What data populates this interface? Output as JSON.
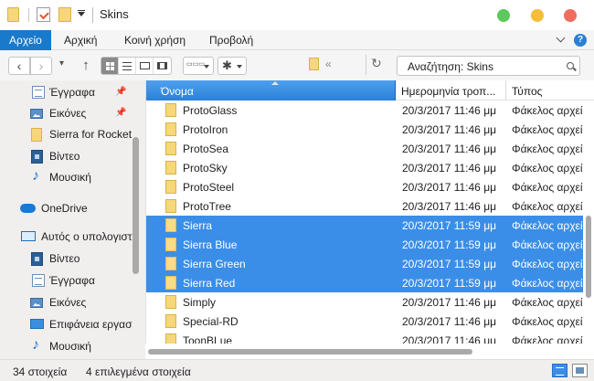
{
  "window": {
    "title": "Skins"
  },
  "ribbon": {
    "tabs": [
      {
        "label": "Αρχείο",
        "active": true
      },
      {
        "label": "Αρχική",
        "active": false
      },
      {
        "label": "Κοινή χρήση",
        "active": false
      },
      {
        "label": "Προβολή",
        "active": false
      }
    ],
    "help": "?"
  },
  "toolbar": {
    "back": "‹",
    "forward": "›",
    "up": "↑",
    "address_overflow": "«",
    "refresh": "↻",
    "search_placeholder": "Αναζήτηση: Skins",
    "gear": "✱",
    "arrange": "▭▭▭"
  },
  "sidebar": {
    "items": [
      {
        "label": "Έγγραφα",
        "icon": "documents-icon",
        "pinned": true
      },
      {
        "label": "Εικόνες",
        "icon": "pictures-icon",
        "pinned": true
      },
      {
        "label": "Sierra for Rocket",
        "icon": "folder-icon",
        "pinned": false
      },
      {
        "label": "Βίντεο",
        "icon": "video-icon",
        "pinned": false
      },
      {
        "label": "Μουσική",
        "icon": "music-icon",
        "pinned": false
      },
      {
        "label": "OneDrive",
        "icon": "onedrive-icon",
        "pinned": false
      },
      {
        "label": "Αυτός ο υπολογιστ",
        "icon": "this-pc-icon",
        "pinned": false
      },
      {
        "label": "Βίντεο",
        "icon": "video-icon",
        "pinned": false
      },
      {
        "label": "Έγγραφα",
        "icon": "documents-icon",
        "pinned": false
      },
      {
        "label": "Εικόνες",
        "icon": "pictures-icon",
        "pinned": false
      },
      {
        "label": "Επιφάνεια εργασ",
        "icon": "desktop-icon",
        "pinned": false
      },
      {
        "label": "Μουσική",
        "icon": "music-icon",
        "pinned": false
      }
    ],
    "pin_glyph": "📌"
  },
  "filelist": {
    "columns": {
      "name": "Όνομα",
      "date": "Ημερομηνία τροπ...",
      "type": "Τύπος"
    },
    "rows": [
      {
        "name": "ProtoGlass",
        "date": "20/3/2017 11:46 μμ",
        "type": "Φάκελος αρχεί",
        "selected": false
      },
      {
        "name": "ProtoIron",
        "date": "20/3/2017 11:46 μμ",
        "type": "Φάκελος αρχεί",
        "selected": false
      },
      {
        "name": "ProtoSea",
        "date": "20/3/2017 11:46 μμ",
        "type": "Φάκελος αρχεί",
        "selected": false
      },
      {
        "name": "ProtoSky",
        "date": "20/3/2017 11:46 μμ",
        "type": "Φάκελος αρχεί",
        "selected": false
      },
      {
        "name": "ProtoSteel",
        "date": "20/3/2017 11:46 μμ",
        "type": "Φάκελος αρχεί",
        "selected": false
      },
      {
        "name": "ProtoTree",
        "date": "20/3/2017 11:46 μμ",
        "type": "Φάκελος αρχεί",
        "selected": false
      },
      {
        "name": "Sierra",
        "date": "20/3/2017 11:59 μμ",
        "type": "Φάκελος αρχεί",
        "selected": true
      },
      {
        "name": "Sierra Blue",
        "date": "20/3/2017 11:59 μμ",
        "type": "Φάκελος αρχεί",
        "selected": true
      },
      {
        "name": "Sierra Green",
        "date": "20/3/2017 11:59 μμ",
        "type": "Φάκελος αρχεί",
        "selected": true
      },
      {
        "name": "Sierra Red",
        "date": "20/3/2017 11:59 μμ",
        "type": "Φάκελος αρχεί",
        "selected": true
      },
      {
        "name": "Simply",
        "date": "20/3/2017 11:46 μμ",
        "type": "Φάκελος αρχεί",
        "selected": false
      },
      {
        "name": "Special-RD",
        "date": "20/3/2017 11:46 μμ",
        "type": "Φάκελος αρχεί",
        "selected": false
      },
      {
        "name": "ToonBLue",
        "date": "20/3/2017 11:46 μμ",
        "type": "Φάκελος αρχεί",
        "selected": false
      }
    ]
  },
  "status": {
    "item_count": "34 στοιχεία",
    "selected_count": "4 επιλεγμένα στοιχεία"
  },
  "colors": {
    "accent": "#1979ca",
    "selection": "#3b8ee8",
    "folder": "#f6d77a",
    "close": "#f06d5e",
    "minimize": "#f4bd3a",
    "maximize": "#5cc95d"
  }
}
